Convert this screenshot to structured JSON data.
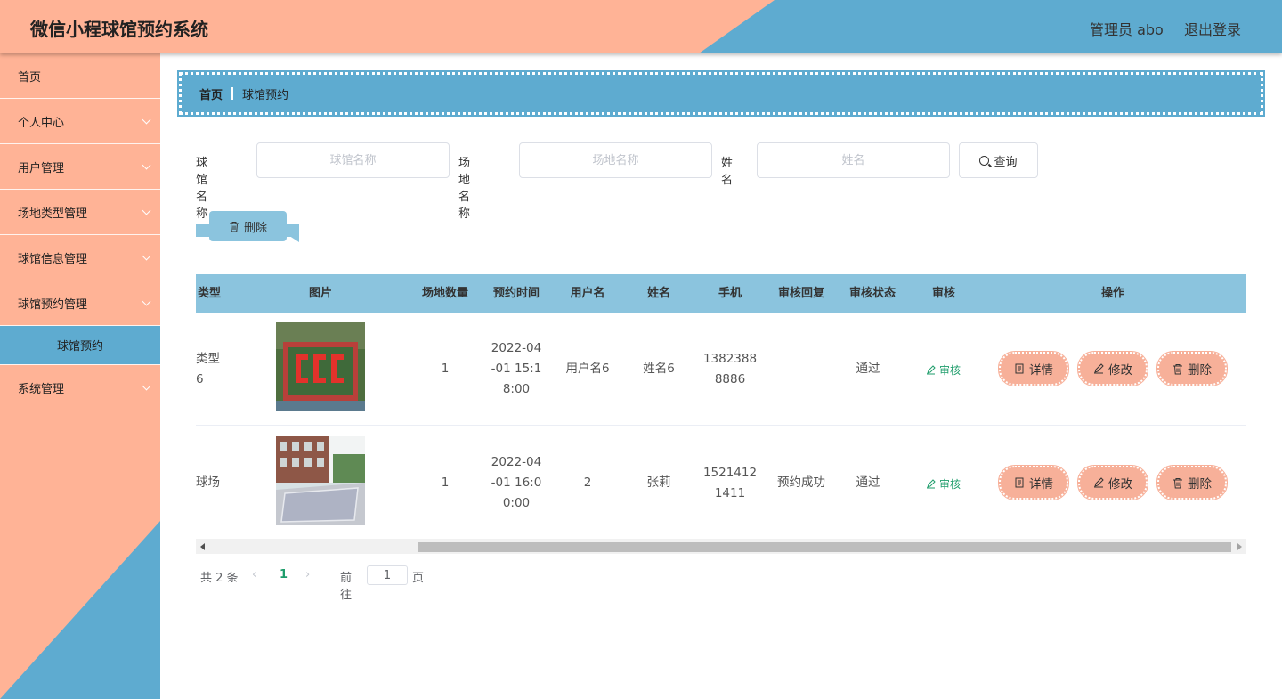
{
  "header": {
    "title": "微信小程球馆预约系统",
    "user": "管理员 abo",
    "logout": "退出登录"
  },
  "sidebar": {
    "items": [
      {
        "label": "首页"
      },
      {
        "label": "个人中心"
      },
      {
        "label": "用户管理"
      },
      {
        "label": "场地类型管理"
      },
      {
        "label": "球馆信息管理"
      },
      {
        "label": "球馆预约管理"
      },
      {
        "label": "球馆预约"
      },
      {
        "label": "系统管理"
      }
    ]
  },
  "breadcrumb": {
    "home": "首页",
    "current": "球馆预约"
  },
  "search": {
    "venue_label": "球馆名称",
    "venue_placeholder": "球馆名称",
    "field_label": "场地名称",
    "field_placeholder": "场地名称",
    "name_label": "姓名",
    "name_placeholder": "姓名",
    "query_button": "查询"
  },
  "actions": {
    "delete_button": "删除"
  },
  "table": {
    "headers": {
      "type": "类型",
      "image": "图片",
      "count": "场地数量",
      "time": "预约时间",
      "username": "用户名",
      "name": "姓名",
      "phone": "手机",
      "reply": "审核回复",
      "status": "审核状态",
      "audit": "审核",
      "ops": "操作"
    },
    "rows": [
      {
        "type_line1": "类型",
        "type_line2": "6",
        "count": "1",
        "time_l1": "2022-04",
        "time_l2": "-01 15:1",
        "time_l3": "8:00",
        "username": "用户名6",
        "name": "姓名6",
        "phone_l1": "1382388",
        "phone_l2": "8886",
        "reply": "",
        "status": "通过",
        "audit": "审核",
        "detail": "详情",
        "edit": "修改",
        "delete": "删除"
      },
      {
        "type_line1": "球场",
        "type_line2": "",
        "count": "1",
        "time_l1": "2022-04",
        "time_l2": "-01 16:0",
        "time_l3": "0:00",
        "username": "2",
        "name": "张莉",
        "phone_l1": "1521412",
        "phone_l2": "1411",
        "reply": "预约成功",
        "status": "通过",
        "audit": "审核",
        "detail": "详情",
        "edit": "修改",
        "delete": "删除"
      }
    ]
  },
  "pagination": {
    "total": "共 2 条",
    "current": "1",
    "goto_label": "前往",
    "page_value": "1",
    "page_suffix": "页"
  },
  "colors": {
    "orange": "#ffb396",
    "blue": "#5eabd0",
    "light_blue": "#8bc4de",
    "button_peach": "#f7b099",
    "green_link": "#1e9d6b"
  }
}
